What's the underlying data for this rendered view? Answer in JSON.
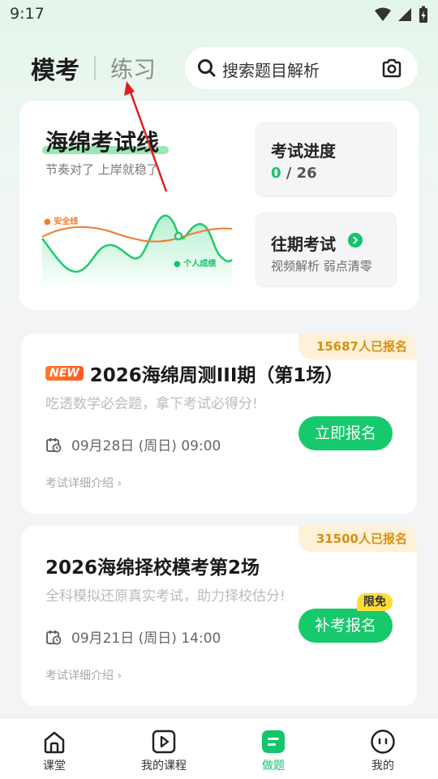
{
  "status_bar": {
    "time": "9:17"
  },
  "top_tabs": {
    "active": "模考",
    "inactive": "练习"
  },
  "search": {
    "placeholder": "搜索题目解析"
  },
  "hero": {
    "title": "海绵考试线",
    "subtitle": "节奏对了 上岸就稳了",
    "chart_labels": {
      "safe_line": "安全线",
      "personal_score": "个人成绩"
    },
    "progress": {
      "title": "考试进度",
      "done": "0",
      "total": "/ 26"
    },
    "past_exams": {
      "title": "往期考试",
      "subtitle": "视频解析 弱点清零"
    }
  },
  "exams": [
    {
      "badge_new": "NEW",
      "title": "2026海绵周测III期（第1场）",
      "desc": "吃透数学必会题，拿下考试必得分!",
      "date": "09月28日 (周日) 09:00",
      "signup_count": "15687人已报名",
      "button": "立即报名",
      "more": "考试详细介绍"
    },
    {
      "title": "2026海绵择校模考第2场",
      "desc": "全科模拟还原真实考试，助力择校估分!",
      "date": "09月21日 (周日) 14:00",
      "signup_count": "31500人已报名",
      "button": "补考报名",
      "free_badge": "限免",
      "more": "考试详细介绍"
    }
  ],
  "bottom_nav": [
    {
      "label": "课堂",
      "icon": "home-icon"
    },
    {
      "label": "我的课程",
      "icon": "play-icon"
    },
    {
      "label": "做题",
      "icon": "practice-icon",
      "active": true
    },
    {
      "label": "我的",
      "icon": "profile-icon"
    }
  ],
  "colors": {
    "accent": "#14c46c",
    "orange": "#f07b2a",
    "badge_bg": "#fdf1d7",
    "badge_text": "#d49116"
  }
}
